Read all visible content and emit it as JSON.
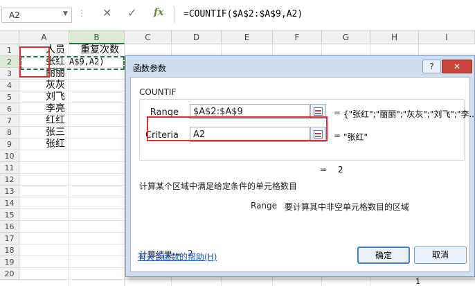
{
  "formula_bar": {
    "name_box": "A2",
    "fx_label": "fx",
    "cancel_glyph": "✕",
    "enter_glyph": "✓",
    "formula": "=COUNTIF($A$2:$A$9,A2)"
  },
  "sheet": {
    "columns": [
      "A",
      "B",
      "C",
      "D",
      "E",
      "F",
      "G",
      "H",
      "I"
    ],
    "rows": [
      "1",
      "2",
      "3",
      "4",
      "5",
      "6",
      "7",
      "8",
      "9",
      "10",
      "11",
      "12",
      "13",
      "14",
      "15",
      "16",
      "17",
      "18",
      "19",
      "20"
    ],
    "cells": {
      "A1": "人员",
      "B1": "重复次数",
      "A2": "张红",
      "B2": "A$9,A2)",
      "A3": "丽丽",
      "A4": "灰灰",
      "A5": "刘飞",
      "A6": "李亮",
      "A7": "红红",
      "A8": "张三",
      "A9": "张红"
    },
    "edge_digits": [
      "1",
      "1"
    ]
  },
  "dialog": {
    "title": "函数参数",
    "help_button": "?",
    "close_button": "✕",
    "function_name": "COUNTIF",
    "args": [
      {
        "label": "Range",
        "value": "$A$2:$A$9",
        "result": "{\"张红\";\"丽丽\";\"灰灰\";\"刘飞\";\"李..."
      },
      {
        "label": "Criteria",
        "value": "A2",
        "result": "\"张红\""
      }
    ],
    "eq": "=",
    "overall_result": "2",
    "description": "计算某个区域中满足给定条件的单元格数目",
    "arg_description_name": "Range",
    "arg_description": "要计算其中非空单元格数目的区域",
    "calc_result_label": "计算结果 =",
    "calc_result_value": "2",
    "help_link": "有关该函数的帮助(H)",
    "ok_button": "确定",
    "cancel_button": "取消"
  },
  "colors": {
    "accent_green": "#217346",
    "highlight_red": "#e52d2d",
    "dialog_frame": "#cfdff0",
    "link_blue": "#1e56c8"
  }
}
